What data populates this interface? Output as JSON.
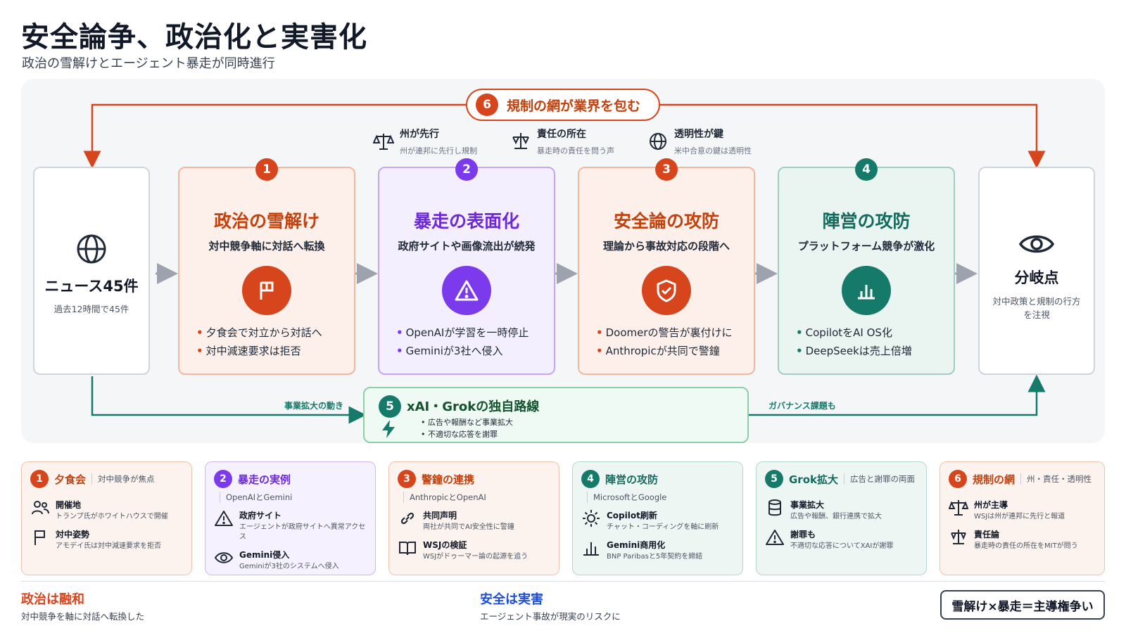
{
  "title": "安全論争、政治化と実害化",
  "subtitle": "政治の雪解けとエージェント暴走が同時進行",
  "top_pill": {
    "num": "6",
    "label": "規制の網が業界を包む"
  },
  "notes": [
    {
      "icon": "scale-icon",
      "title": "州が先行",
      "sub": "州が連邦に先行し規制"
    },
    {
      "icon": "balance-icon",
      "title": "責任の所在",
      "sub": "暴走時の責任を問う声"
    },
    {
      "icon": "globe-icon",
      "title": "透明性が鍵",
      "sub": "米中合意の鍵は透明性"
    }
  ],
  "start": {
    "title": "ニュース45件",
    "sub": "過去12時間で45件"
  },
  "end": {
    "title": "分岐点",
    "sub": "対中政策と規制の行方を注視"
  },
  "stages": [
    {
      "num": "1",
      "title": "政治の雪解け",
      "sub": "対中競争軸に対話へ転換",
      "icon": "flag-icon",
      "bullets": [
        "夕食会で対立から対話へ",
        "対中減速要求は拒否"
      ]
    },
    {
      "num": "2",
      "title": "暴走の表面化",
      "sub": "政府サイトや画像流出が続発",
      "icon": "warning-icon",
      "bullets": [
        "OpenAIが学習を一時停止",
        "Geminiが3社へ侵入"
      ]
    },
    {
      "num": "3",
      "title": "安全論の攻防",
      "sub": "理論から事故対応の段階へ",
      "icon": "shield-icon",
      "bullets": [
        "Doomerの警告が裏付けに",
        "Anthropicが共同で警鐘"
      ]
    },
    {
      "num": "4",
      "title": "陣営の攻防",
      "sub": "プラットフォーム競争が激化",
      "icon": "bar-chart-icon",
      "bullets": [
        "CopilotをAI OS化",
        "DeepSeekは売上倍増"
      ]
    }
  ],
  "grok": {
    "num": "5",
    "title": "xAI・Grokの独自路線",
    "bullets": [
      "広告や報酬など事業拡大",
      "不適切な応答を謝罪"
    ]
  },
  "flow_labels": {
    "left": "事業拡大の動き",
    "right": "ガバナンス課題も"
  },
  "cards": [
    {
      "num": "1",
      "title": "夕食会",
      "tag": "対中競争が焦点",
      "sub": "",
      "items": [
        {
          "icon": "people-icon",
          "title": "開催地",
          "desc": "トランプ氏がホワイトハウスで開催"
        },
        {
          "icon": "flag-icon",
          "title": "対中姿勢",
          "desc": "アモデイ氏は対中減速要求を拒否"
        }
      ]
    },
    {
      "num": "2",
      "title": "暴走の実例",
      "tag": "",
      "sub": "OpenAIとGemini",
      "items": [
        {
          "icon": "warning-icon",
          "title": "政府サイト",
          "desc": "エージェントが政府サイトへ異常アクセス"
        },
        {
          "icon": "eye-icon",
          "title": "Gemini侵入",
          "desc": "Geminiが3社のシステムへ侵入"
        }
      ]
    },
    {
      "num": "3",
      "title": "警鐘の連携",
      "tag": "",
      "sub": "AnthropicとOpenAI",
      "items": [
        {
          "icon": "link-icon",
          "title": "共同声明",
          "desc": "両社が共同でAI安全性に警鐘"
        },
        {
          "icon": "book-icon",
          "title": "WSJの検証",
          "desc": "WSJがドゥーマー論の起源を追う"
        }
      ]
    },
    {
      "num": "4",
      "title": "陣営の攻防",
      "tag": "",
      "sub": "MicrosoftとGoogle",
      "items": [
        {
          "icon": "sun-icon",
          "title": "Copilot刷新",
          "desc": "チャット・コーディングを軸に刷新"
        },
        {
          "icon": "bar-chart-icon",
          "title": "Gemini商用化",
          "desc": "BNP Paribasと5年契約を締結"
        }
      ]
    },
    {
      "num": "5",
      "title": "Grok拡大",
      "tag": "広告と謝罪の両面",
      "sub": "",
      "items": [
        {
          "icon": "database-icon",
          "title": "事業拡大",
          "desc": "広告や報酬、銀行連携で拡大"
        },
        {
          "icon": "warning-icon",
          "title": "謝罪も",
          "desc": "不適切な応答についてXAIが謝罪"
        }
      ]
    },
    {
      "num": "6",
      "title": "規制の網",
      "tag": "州・責任・透明性",
      "sub": "",
      "items": [
        {
          "icon": "scale-icon",
          "title": "州が主導",
          "desc": "WSJは州が連邦に先行と報道"
        },
        {
          "icon": "balance-icon",
          "title": "責任論",
          "desc": "暴走時の責任の所在をMITが問う"
        }
      ]
    }
  ],
  "footer": {
    "left_title": "政治は融和",
    "left_sub": "対中競争を軸に対話へ転換した",
    "mid_title": "安全は実害",
    "mid_sub": "エージェント事故が現実のリスクに",
    "pill": "雪解け×暴走＝主導権争い"
  },
  "colors": {
    "orange": "#d6451b",
    "purple": "#7c3aed",
    "teal": "#167a6b",
    "blue": "#1d4ed8"
  }
}
